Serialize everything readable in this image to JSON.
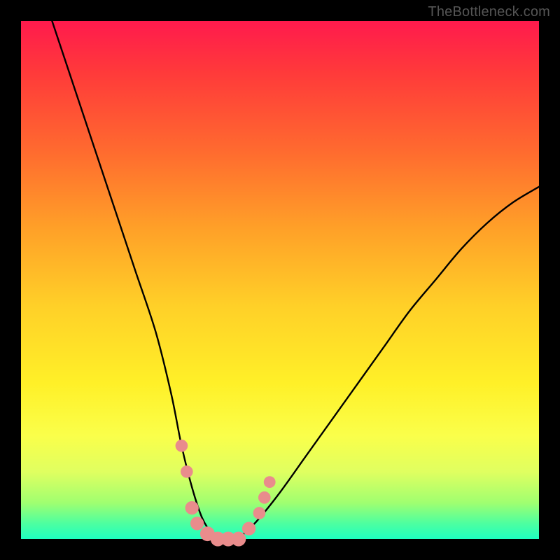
{
  "watermark": "TheBottleneck.com",
  "chart_data": {
    "type": "line",
    "title": "",
    "xlabel": "",
    "ylabel": "",
    "xlim": [
      0,
      100
    ],
    "ylim": [
      0,
      100
    ],
    "gradient_bands": [
      {
        "label": "bottleneck-high",
        "color": "#ff1a4d",
        "y_pct": 100
      },
      {
        "label": "bottleneck-mid",
        "color": "#ffd028",
        "y_pct": 50
      },
      {
        "label": "bottleneck-none",
        "color": "#1effc0",
        "y_pct": 0
      }
    ],
    "series": [
      {
        "name": "bottleneck-curve",
        "color": "#000000",
        "x": [
          6,
          10,
          14,
          18,
          22,
          26,
          29,
          31,
          33,
          35,
          37,
          39,
          41,
          43,
          46,
          50,
          55,
          60,
          65,
          70,
          75,
          80,
          85,
          90,
          95,
          100
        ],
        "y": [
          100,
          88,
          76,
          64,
          52,
          40,
          28,
          18,
          10,
          4,
          1,
          0,
          0,
          1,
          4,
          9,
          16,
          23,
          30,
          37,
          44,
          50,
          56,
          61,
          65,
          68
        ]
      }
    ],
    "markers": {
      "name": "sample-points",
      "color": "#e98c8c",
      "points": [
        {
          "x": 31,
          "y": 18,
          "r": 2.1
        },
        {
          "x": 32,
          "y": 13,
          "r": 2.1
        },
        {
          "x": 33,
          "y": 6,
          "r": 2.3
        },
        {
          "x": 34,
          "y": 3,
          "r": 2.3
        },
        {
          "x": 36,
          "y": 1,
          "r": 2.5
        },
        {
          "x": 38,
          "y": 0,
          "r": 2.5
        },
        {
          "x": 40,
          "y": 0,
          "r": 2.5
        },
        {
          "x": 42,
          "y": 0,
          "r": 2.5
        },
        {
          "x": 44,
          "y": 2,
          "r": 2.3
        },
        {
          "x": 46,
          "y": 5,
          "r": 2.1
        },
        {
          "x": 47,
          "y": 8,
          "r": 2.1
        },
        {
          "x": 48,
          "y": 11,
          "r": 2.0
        }
      ]
    }
  }
}
